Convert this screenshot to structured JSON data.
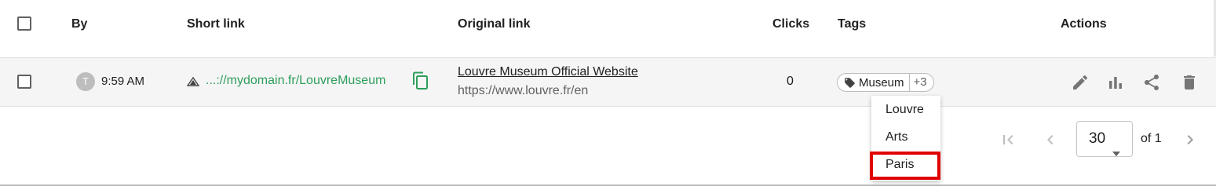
{
  "header": {
    "by": "By",
    "short_link": "Short link",
    "original_link": "Original link",
    "clicks": "Clicks",
    "tags": "Tags",
    "actions": "Actions"
  },
  "row": {
    "avatar_letter": "T",
    "time": "9:59 AM",
    "short_link": "...://mydomain.fr/LouvreMuseum",
    "original_title": "Louvre Museum Official Website",
    "original_url": "https://www.louvre.fr/en",
    "clicks": "0",
    "tag": "Museum",
    "tag_more": "+3"
  },
  "tag_dropdown": {
    "items": [
      "Louvre",
      "Arts",
      "Paris"
    ]
  },
  "pagination": {
    "page_size": "30",
    "of_label": "of 1"
  },
  "colors": {
    "short_link": "#2e9e5b",
    "highlight": "#e00000",
    "row_bg": "#f5f5f5"
  }
}
